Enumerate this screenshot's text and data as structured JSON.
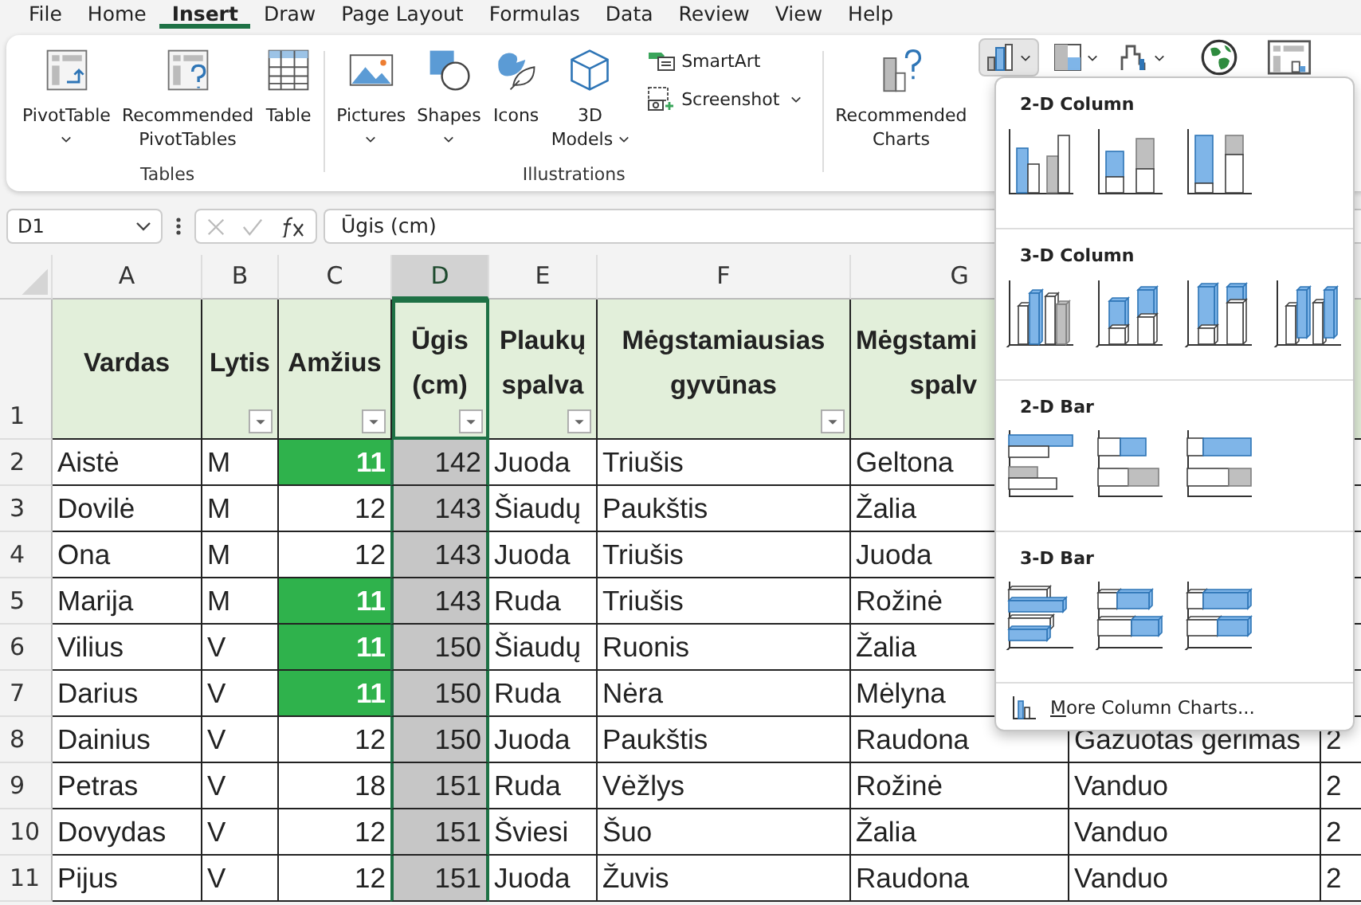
{
  "menu_tabs": [
    {
      "label": "File",
      "selected": false
    },
    {
      "label": "Home",
      "selected": false
    },
    {
      "label": "Insert",
      "selected": true
    },
    {
      "label": "Draw",
      "selected": false
    },
    {
      "label": "Page Layout",
      "selected": false
    },
    {
      "label": "Formulas",
      "selected": false
    },
    {
      "label": "Data",
      "selected": false
    },
    {
      "label": "Review",
      "selected": false
    },
    {
      "label": "View",
      "selected": false
    },
    {
      "label": "Help",
      "selected": false
    }
  ],
  "ribbon": {
    "groups": [
      {
        "label": "Tables",
        "items": [
          {
            "kind": "pivot",
            "label": "PivotTable",
            "menu_below": true
          },
          {
            "kind": "recpivot",
            "label": "Recommended\nPivotTables"
          },
          {
            "kind": "table",
            "label": "Table"
          }
        ]
      },
      {
        "label": "Illustrations",
        "items": [
          {
            "kind": "pictures",
            "label": "Pictures",
            "menu_below": true
          },
          {
            "kind": "shapes",
            "label": "Shapes",
            "menu_below": true
          },
          {
            "kind": "icons",
            "label": "Icons"
          },
          {
            "kind": "models",
            "label": "3D\nModels",
            "menu_inline": true
          }
        ],
        "small_items": [
          {
            "kind": "smartart",
            "label": "SmartArt"
          },
          {
            "kind": "screenshot",
            "label": "Screenshot",
            "menu_inline": true
          }
        ]
      },
      {
        "items": [
          {
            "kind": "recchart",
            "label": "Recommended\nCharts"
          }
        ],
        "chart_buttons": [
          {
            "kind": "column",
            "selected": true
          },
          {
            "kind": "hierarchy",
            "selected": false
          },
          {
            "kind": "waterfall",
            "selected": false
          },
          {
            "kind": "maps",
            "selected": false
          },
          {
            "kind": "pivotchart",
            "selected": false
          }
        ]
      }
    ]
  },
  "formula_bar": {
    "name_box": "D1",
    "formula": "Ūgis (cm)"
  },
  "columns": [
    {
      "letter": "A",
      "selected": false,
      "numeric": false
    },
    {
      "letter": "B",
      "selected": false,
      "numeric": false
    },
    {
      "letter": "C",
      "selected": false,
      "numeric": true
    },
    {
      "letter": "D",
      "selected": true,
      "numeric": true
    },
    {
      "letter": "E",
      "selected": false,
      "numeric": false
    },
    {
      "letter": "F",
      "selected": false,
      "numeric": false
    },
    {
      "letter": "G",
      "selected": false,
      "numeric": false
    },
    {
      "selected": false
    },
    {
      "selected": false
    }
  ],
  "header_row": {
    "number": "1",
    "cells": [
      {
        "text": "Vardas",
        "filter": false
      },
      {
        "text": "Lytis",
        "filter": true
      },
      {
        "text": "Amžius",
        "filter": true
      },
      {
        "text": "Ūgis\n(cm)",
        "filter": true
      },
      {
        "text": "Plaukų\nspalva",
        "filter": true
      },
      {
        "text": "Mėgstamiausias\ngyvūnas",
        "filter": true
      },
      {
        "text": "Mėgstami\nspalv"
      }
    ]
  },
  "rows": [
    {
      "number": "2",
      "cells": [
        {
          "text": "Aistė"
        },
        {
          "text": "M"
        },
        {
          "text": "11",
          "highlighted": true
        },
        {
          "text": "142"
        },
        {
          "text": "Juoda"
        },
        {
          "text": "Triušis"
        },
        {
          "text": "Geltona"
        }
      ]
    },
    {
      "number": "3",
      "cells": [
        {
          "text": "Dovilė"
        },
        {
          "text": "M"
        },
        {
          "text": "12",
          "highlighted": false
        },
        {
          "text": "143"
        },
        {
          "text": "Šiaudų"
        },
        {
          "text": "Paukštis"
        },
        {
          "text": "Žalia"
        }
      ]
    },
    {
      "number": "4",
      "cells": [
        {
          "text": "Ona"
        },
        {
          "text": "M"
        },
        {
          "text": "12",
          "highlighted": false
        },
        {
          "text": "143"
        },
        {
          "text": "Juoda"
        },
        {
          "text": "Triušis"
        },
        {
          "text": "Juoda"
        }
      ]
    },
    {
      "number": "5",
      "cells": [
        {
          "text": "Marija"
        },
        {
          "text": "M"
        },
        {
          "text": "11",
          "highlighted": true
        },
        {
          "text": "143"
        },
        {
          "text": "Ruda"
        },
        {
          "text": "Triušis"
        },
        {
          "text": "Rožinė"
        }
      ]
    },
    {
      "number": "6",
      "cells": [
        {
          "text": "Vilius"
        },
        {
          "text": "V"
        },
        {
          "text": "11",
          "highlighted": true
        },
        {
          "text": "150"
        },
        {
          "text": "Šiaudų"
        },
        {
          "text": "Ruonis"
        },
        {
          "text": "Žalia"
        }
      ]
    },
    {
      "number": "7",
      "cells": [
        {
          "text": "Darius"
        },
        {
          "text": "V"
        },
        {
          "text": "11",
          "highlighted": true
        },
        {
          "text": "150"
        },
        {
          "text": "Ruda"
        },
        {
          "text": "Nėra"
        },
        {
          "text": "Mėlyna"
        }
      ]
    },
    {
      "number": "8",
      "cells": [
        {
          "text": "Dainius"
        },
        {
          "text": "V"
        },
        {
          "text": "12",
          "highlighted": false
        },
        {
          "text": "150"
        },
        {
          "text": "Juoda"
        },
        {
          "text": "Paukštis"
        },
        {
          "text": "Raudona"
        },
        {
          "text": "Gazuotas gerimas"
        },
        {
          "text": "2"
        }
      ]
    },
    {
      "number": "9",
      "cells": [
        {
          "text": "Petras"
        },
        {
          "text": "V"
        },
        {
          "text": "18",
          "highlighted": false
        },
        {
          "text": "151"
        },
        {
          "text": "Ruda"
        },
        {
          "text": "Vėžlys"
        },
        {
          "text": "Rožinė"
        },
        {
          "text": "Vanduo"
        },
        {
          "text": "2"
        }
      ]
    },
    {
      "number": "10",
      "cells": [
        {
          "text": "Dovydas"
        },
        {
          "text": "V"
        },
        {
          "text": "12",
          "highlighted": false
        },
        {
          "text": "151"
        },
        {
          "text": "Šviesi"
        },
        {
          "text": "Šuo"
        },
        {
          "text": "Žalia"
        },
        {
          "text": "Vanduo"
        },
        {
          "text": "2"
        }
      ]
    },
    {
      "number": "11",
      "cells": [
        {
          "text": "Pijus"
        },
        {
          "text": "V"
        },
        {
          "text": "12",
          "highlighted": false
        },
        {
          "text": "151"
        },
        {
          "text": "Juoda"
        },
        {
          "text": "Žuvis"
        },
        {
          "text": "Raudona"
        },
        {
          "text": "Vanduo"
        },
        {
          "text": "2"
        }
      ]
    }
  ],
  "chart_menu": {
    "sections": [
      {
        "title": "2-D Column",
        "kind": "column2d"
      },
      {
        "title": "3-D Column",
        "kind": "column3d"
      },
      {
        "title": "2-D Bar",
        "kind": "bar2d"
      },
      {
        "title": "3-D Bar",
        "kind": "bar3d"
      }
    ],
    "more_link": "More Column Charts..."
  }
}
